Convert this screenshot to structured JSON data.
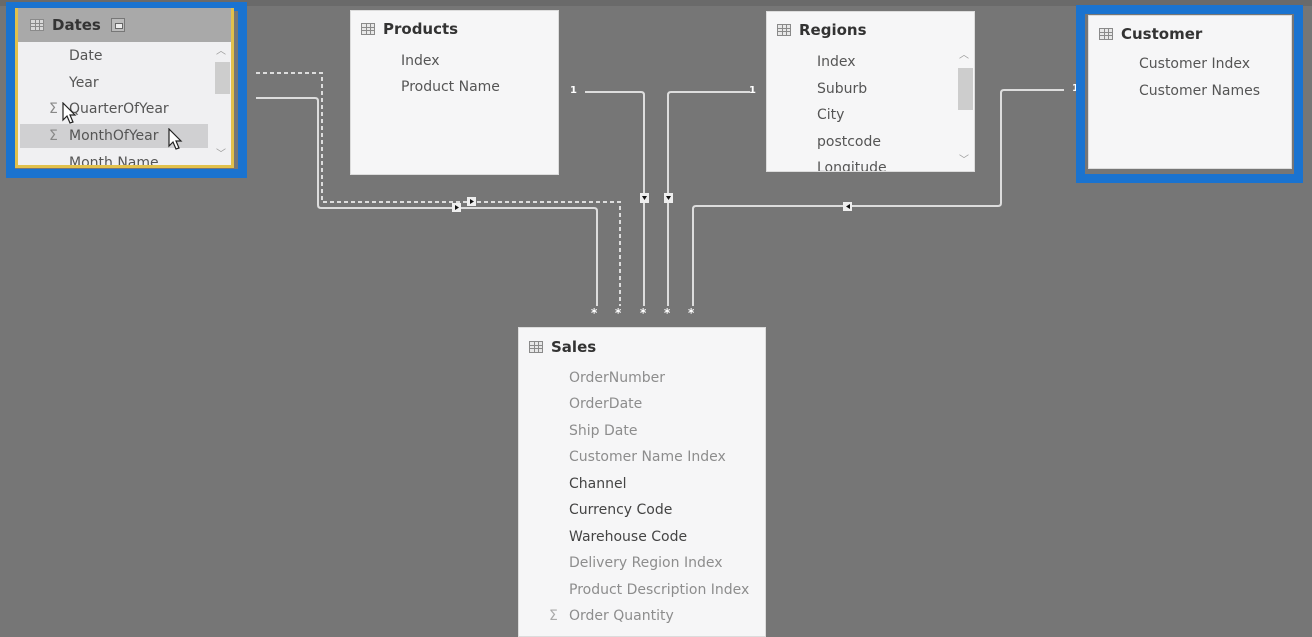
{
  "view": "Model relationships",
  "colors": {
    "canvas_bg": "#767676",
    "card_bg": "#f6f6f7",
    "selection_frame": "#1a73d0",
    "selected_card_border": "#e8c84a",
    "relationship_line": "#dddddd"
  },
  "tables": {
    "dates": {
      "title": "Dates",
      "header_icon": "table-icon",
      "collapse_icon": "minimize-icon",
      "selected": true,
      "fields": [
        {
          "name": "Date",
          "icon": ""
        },
        {
          "name": "Year",
          "icon": ""
        },
        {
          "name": "QuarterOfYear",
          "icon": "Σ"
        },
        {
          "name": "MonthOfYear",
          "icon": "Σ",
          "hovered": true
        },
        {
          "name": "Month Name",
          "icon": ""
        }
      ]
    },
    "products": {
      "title": "Products",
      "header_icon": "table-icon",
      "fields": [
        {
          "name": "Index"
        },
        {
          "name": "Product Name"
        }
      ]
    },
    "regions": {
      "title": "Regions",
      "header_icon": "table-icon",
      "fields": [
        {
          "name": "Index"
        },
        {
          "name": "Suburb"
        },
        {
          "name": "City"
        },
        {
          "name": "postcode"
        },
        {
          "name": "Longitude"
        }
      ]
    },
    "customer": {
      "title": "Customer",
      "header_icon": "table-icon",
      "selected": true,
      "fields": [
        {
          "name": "Customer Index"
        },
        {
          "name": "Customer Names"
        }
      ]
    },
    "sales": {
      "title": "Sales",
      "header_icon": "table-icon",
      "fields": [
        {
          "name": "OrderNumber",
          "icon": ""
        },
        {
          "name": "OrderDate",
          "icon": ""
        },
        {
          "name": "Ship Date",
          "icon": ""
        },
        {
          "name": "Customer Name Index",
          "icon": ""
        },
        {
          "name": "Channel",
          "icon": ""
        },
        {
          "name": "Currency Code",
          "icon": ""
        },
        {
          "name": "Warehouse Code",
          "icon": ""
        },
        {
          "name": "Delivery Region Index",
          "icon": ""
        },
        {
          "name": "Product Description Index",
          "icon": ""
        },
        {
          "name": "Order Quantity",
          "icon": "Σ"
        }
      ]
    }
  },
  "relationships": [
    {
      "from": "Dates",
      "to": "Sales",
      "one_label": "",
      "many_label": "*",
      "active": true
    },
    {
      "from": "Dates",
      "to": "Sales",
      "one_label": "",
      "many_label": "*",
      "active": false
    },
    {
      "from": "Products",
      "to": "Sales",
      "one_label": "1",
      "many_label": "*",
      "active": true
    },
    {
      "from": "Regions",
      "to": "Sales",
      "one_label": "1",
      "many_label": "*",
      "active": true
    },
    {
      "from": "Customer",
      "to": "Sales",
      "one_label": "1",
      "many_label": "*",
      "active": true
    }
  ]
}
